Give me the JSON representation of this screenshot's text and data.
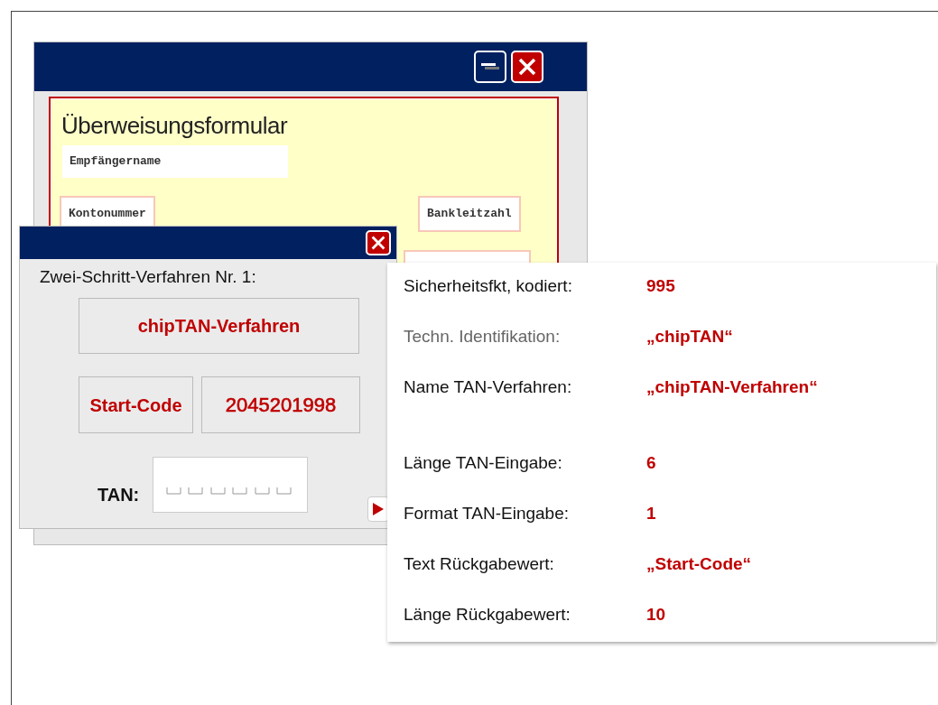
{
  "main_window": {
    "form_title": "Überweisungsformular",
    "fields": [
      {
        "label": "Empfängername",
        "kind": "plain"
      },
      {
        "label": "Kontonummer",
        "kind": "outlined"
      },
      {
        "label": "Bankleitzahl",
        "kind": "outlined"
      }
    ]
  },
  "dialog": {
    "heading": "Zwei-Schritt-Verfahren Nr. 1:",
    "method": "chipTAN-Verfahren",
    "return_label": "Start-Code",
    "return_value": "2045201998",
    "tan_label": "TAN:"
  },
  "info_groups": [
    [
      {
        "label": "Sicherheitsfkt, kodiert:",
        "value": "995",
        "muted": false
      },
      {
        "label": "Techn. Identifikation:",
        "value": "„chipTAN“",
        "muted": true
      },
      {
        "label": "Name TAN-Verfahren:",
        "value": "„chipTAN-Verfahren“",
        "muted": false
      }
    ],
    [
      {
        "label": "Länge TAN-Eingabe:",
        "value": "6",
        "muted": false
      },
      {
        "label": "Format TAN-Eingabe:",
        "value": "1",
        "muted": false
      },
      {
        "label": "Text Rückgabewert:",
        "value": "„Start-Code“",
        "muted": false
      },
      {
        "label": "Länge Rückgabewert:",
        "value": "10",
        "muted": false
      }
    ]
  ]
}
